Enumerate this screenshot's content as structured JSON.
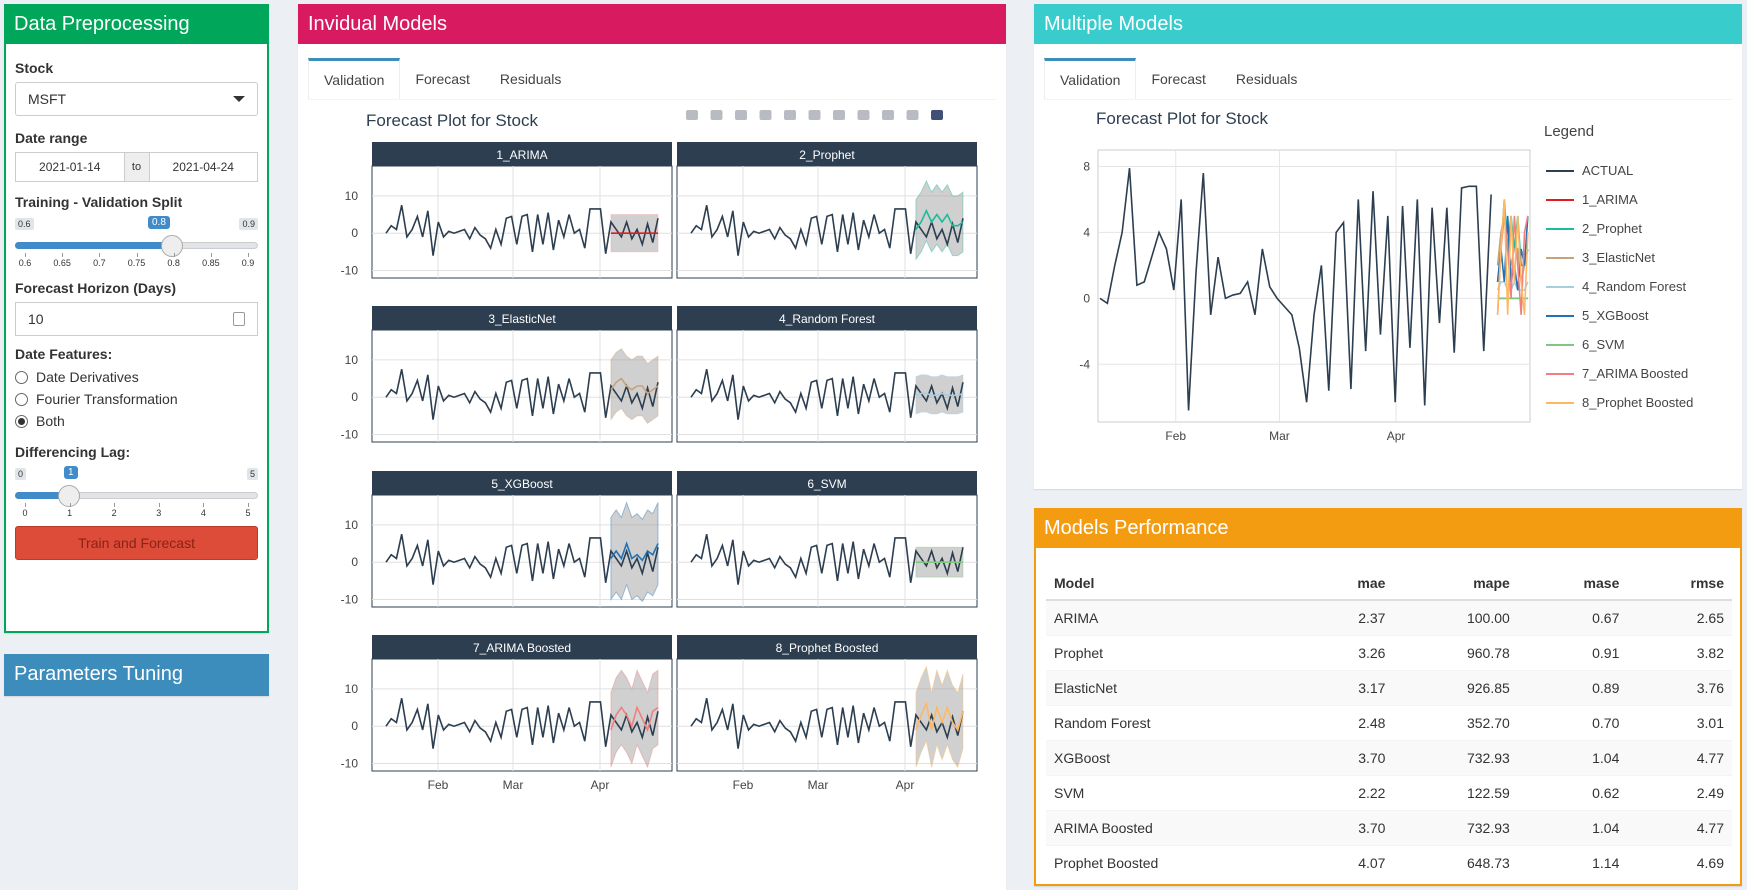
{
  "prep": {
    "title": "Data Preprocessing",
    "stock_label": "Stock",
    "stock_value": "MSFT",
    "date_label": "Date range",
    "date_start": "2021-01-14",
    "date_to": "to",
    "date_end": "2021-04-24",
    "split_label": "Training - Validation Split",
    "split_min": "0.6",
    "split_max": "0.9",
    "split_value": "0.8",
    "split_ticks": [
      "0.6",
      "0.65",
      "0.7",
      "0.75",
      "0.8",
      "0.85",
      "0.9"
    ],
    "horizon_label": "Forecast Horizon (Days)",
    "horizon_value": "10",
    "features_label": "Date Features:",
    "features": [
      "Date Derivatives",
      "Fourier Transformation",
      "Both"
    ],
    "features_selected": "Both",
    "lag_label": "Differencing Lag:",
    "lag_min": "0",
    "lag_max": "5",
    "lag_value": "1",
    "lag_ticks": [
      "0",
      "1",
      "2",
      "3",
      "4",
      "5"
    ],
    "train_button": "Train and Forecast"
  },
  "tuning": {
    "title": "Parameters Tuning"
  },
  "indiv": {
    "title": "Invidual Models",
    "tabs": [
      "Validation",
      "Forecast",
      "Residuals"
    ],
    "plot_title": "Forecast Plot for Stock"
  },
  "multi": {
    "title": "Multiple Models",
    "tabs": [
      "Validation",
      "Forecast",
      "Residuals"
    ],
    "plot_title": "Forecast Plot for Stock",
    "legend_title": "Legend"
  },
  "perf": {
    "title": "Models Performance",
    "headers": [
      "Model",
      "mae",
      "mape",
      "mase",
      "rmse"
    ],
    "rows": [
      [
        "ARIMA",
        "2.37",
        "100.00",
        "0.67",
        "2.65"
      ],
      [
        "Prophet",
        "3.26",
        "960.78",
        "0.91",
        "3.82"
      ],
      [
        "ElasticNet",
        "3.17",
        "926.85",
        "0.89",
        "3.76"
      ],
      [
        "Random Forest",
        "2.48",
        "352.70",
        "0.70",
        "3.01"
      ],
      [
        "XGBoost",
        "3.70",
        "732.93",
        "1.04",
        "4.77"
      ],
      [
        "SVM",
        "2.22",
        "122.59",
        "0.62",
        "2.49"
      ],
      [
        "ARIMA Boosted",
        "3.70",
        "732.93",
        "1.04",
        "4.77"
      ],
      [
        "Prophet Boosted",
        "4.07",
        "648.73",
        "1.14",
        "4.69"
      ]
    ]
  },
  "chart_data": [
    {
      "type": "line",
      "title": "Forecast Plot for Stock",
      "facets": [
        "1_ARIMA",
        "2_Prophet",
        "3_ElasticNet",
        "4_Random Forest",
        "5_XGBoost",
        "6_SVM",
        "7_ARIMA Boosted",
        "8_Prophet Boosted"
      ],
      "x_ticks": [
        "Feb",
        "Mar",
        "Apr"
      ],
      "y_ticks": [
        -10,
        0,
        10
      ],
      "ylim": [
        -12,
        18
      ],
      "actual": [
        0,
        2,
        1,
        7.5,
        -1,
        1,
        4.5,
        -1,
        6,
        -6,
        3,
        -1,
        0.5,
        0,
        0.5,
        1,
        -1.5,
        1.5,
        -0.5,
        -1.5,
        -4,
        1,
        -3,
        4,
        4.5,
        -3,
        4.5,
        5,
        -5,
        5,
        -3,
        5.5,
        -4.5,
        3.5,
        -1,
        5,
        0,
        1,
        -4,
        6.5,
        6.5,
        6.5,
        -5.5,
        3,
        1,
        -1,
        3,
        -1.5,
        1,
        -3,
        2.5,
        -2.5,
        4
      ],
      "forecast_start": 43,
      "series_colors": [
        "#e41a1c",
        "#1abc9c",
        "#c8a27c",
        "#a6cee3",
        "#2171b5",
        "#7fc97f",
        "#f08080",
        "#fdb863"
      ],
      "forecasts": [
        [
          0,
          0,
          0,
          0,
          0,
          0,
          0,
          0,
          0,
          0
        ],
        [
          1,
          3,
          6,
          3,
          5,
          3,
          5,
          2,
          2,
          3
        ],
        [
          2,
          4,
          5,
          3,
          2,
          3,
          3,
          1,
          2,
          3
        ],
        [
          0.5,
          1,
          1,
          0.5,
          0.5,
          1,
          0.5,
          0.5,
          0.5,
          1
        ],
        [
          1,
          3,
          1,
          5,
          1,
          2,
          0.5,
          3,
          2,
          5
        ],
        [
          0,
          0,
          0,
          0,
          0,
          0,
          0,
          0,
          0,
          0
        ],
        [
          -1,
          3,
          5,
          3,
          0,
          5,
          2,
          -1,
          4,
          5
        ],
        [
          -1,
          3,
          6,
          -1,
          5,
          1,
          5,
          1,
          -1,
          4
        ]
      ],
      "band_widths": [
        5,
        8,
        8,
        5,
        11,
        4,
        10,
        10
      ]
    },
    {
      "type": "line",
      "title": "Forecast Plot for Stock",
      "x_ticks": [
        "Feb",
        "Mar",
        "Apr"
      ],
      "y_ticks": [
        8,
        4,
        0,
        -4
      ],
      "ylim": [
        -7.5,
        9
      ],
      "legend_title": "Legend",
      "series": [
        {
          "name": "ACTUAL",
          "color": "#2c3e50"
        },
        {
          "name": "1_ARIMA",
          "color": "#e41a1c"
        },
        {
          "name": "2_Prophet",
          "color": "#1abc9c"
        },
        {
          "name": "3_ElasticNet",
          "color": "#c8a27c"
        },
        {
          "name": "4_Random Forest",
          "color": "#a6cee3"
        },
        {
          "name": "5_XGBoost",
          "color": "#2171b5"
        },
        {
          "name": "6_SVM",
          "color": "#7fc97f"
        },
        {
          "name": "7_ARIMA Boosted",
          "color": "#f08080"
        },
        {
          "name": "8_Prophet Boosted",
          "color": "#fdb863"
        }
      ],
      "actual": [
        0,
        -0.3,
        2,
        4,
        7.9,
        0.8,
        1,
        2.5,
        4,
        3,
        0.5,
        6,
        -6.8,
        1.5,
        7.6,
        -1,
        2.5,
        0,
        0.2,
        0.3,
        1,
        -1,
        3,
        0.7,
        0,
        -0.5,
        -1,
        -3,
        -6.3,
        -1,
        2,
        -5.6,
        4,
        4.6,
        -5.5,
        6,
        -3.2,
        6.5,
        -2.2,
        5,
        -6.3,
        5.6,
        -3,
        6,
        -6.5,
        5.5,
        -1.5,
        5.5,
        -3.3,
        6.7,
        6.8,
        6.8,
        -3.2,
        6.3
      ]
    }
  ]
}
